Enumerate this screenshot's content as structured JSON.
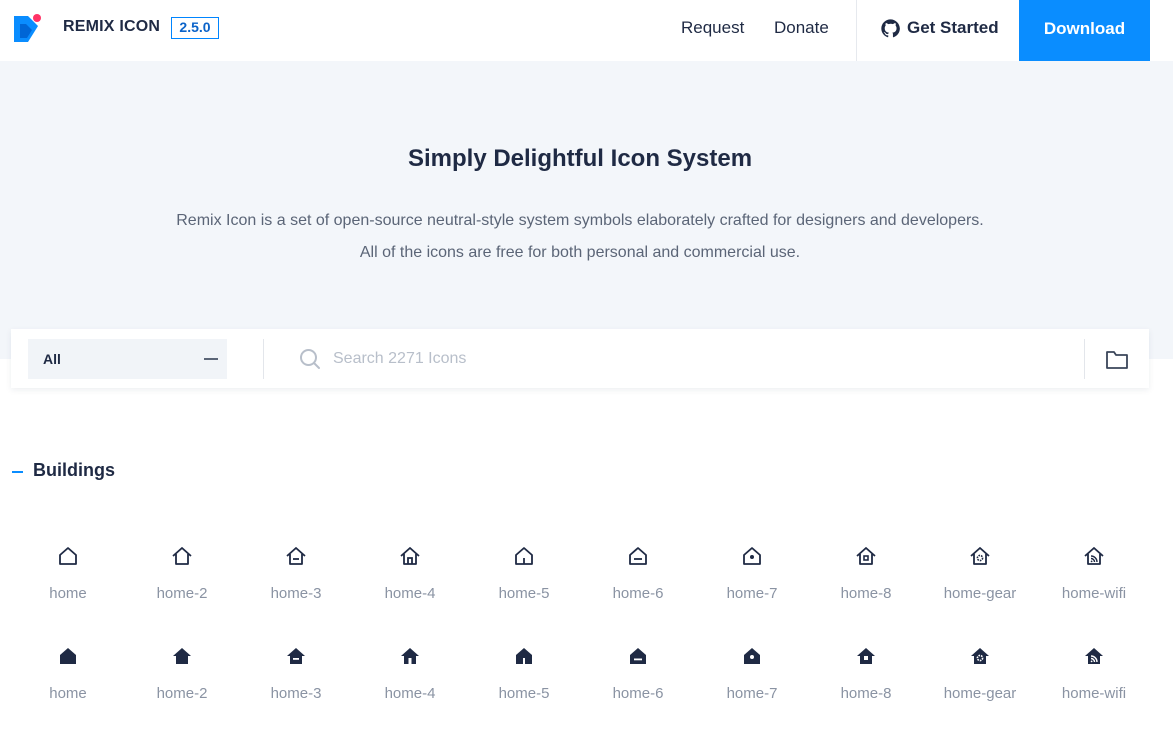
{
  "header": {
    "brand": "REMIX ICON",
    "version": "2.5.0",
    "nav": {
      "request": "Request",
      "donate": "Donate"
    },
    "get_started": "Get Started",
    "download": "Download",
    "colors": {
      "accent": "#0a8dff",
      "logo_dot": "#ff3366"
    }
  },
  "hero": {
    "title": "Simply Delightful Icon System",
    "desc_line1": "Remix Icon is a set of open-source neutral-style system symbols elaborately crafted for designers and developers.",
    "desc_line2": "All of the icons are free for both personal and commercial use."
  },
  "search": {
    "category": "All",
    "placeholder": "Search 2271 Icons"
  },
  "section": {
    "title": "Buildings",
    "line_icons": [
      {
        "label": "home",
        "icon": "home-line-icon"
      },
      {
        "label": "home-2",
        "icon": "home-2-line-icon"
      },
      {
        "label": "home-3",
        "icon": "home-3-line-icon"
      },
      {
        "label": "home-4",
        "icon": "home-4-line-icon"
      },
      {
        "label": "home-5",
        "icon": "home-5-line-icon"
      },
      {
        "label": "home-6",
        "icon": "home-6-line-icon"
      },
      {
        "label": "home-7",
        "icon": "home-7-line-icon"
      },
      {
        "label": "home-8",
        "icon": "home-8-line-icon"
      },
      {
        "label": "home-gear",
        "icon": "home-gear-line-icon"
      },
      {
        "label": "home-wifi",
        "icon": "home-wifi-line-icon"
      }
    ],
    "fill_icons": [
      {
        "label": "home",
        "icon": "home-fill-icon"
      },
      {
        "label": "home-2",
        "icon": "home-2-fill-icon"
      },
      {
        "label": "home-3",
        "icon": "home-3-fill-icon"
      },
      {
        "label": "home-4",
        "icon": "home-4-fill-icon"
      },
      {
        "label": "home-5",
        "icon": "home-5-fill-icon"
      },
      {
        "label": "home-6",
        "icon": "home-6-fill-icon"
      },
      {
        "label": "home-7",
        "icon": "home-7-fill-icon"
      },
      {
        "label": "home-8",
        "icon": "home-8-fill-icon"
      },
      {
        "label": "home-gear",
        "icon": "home-gear-fill-icon"
      },
      {
        "label": "home-wifi",
        "icon": "home-wifi-fill-icon"
      }
    ]
  }
}
